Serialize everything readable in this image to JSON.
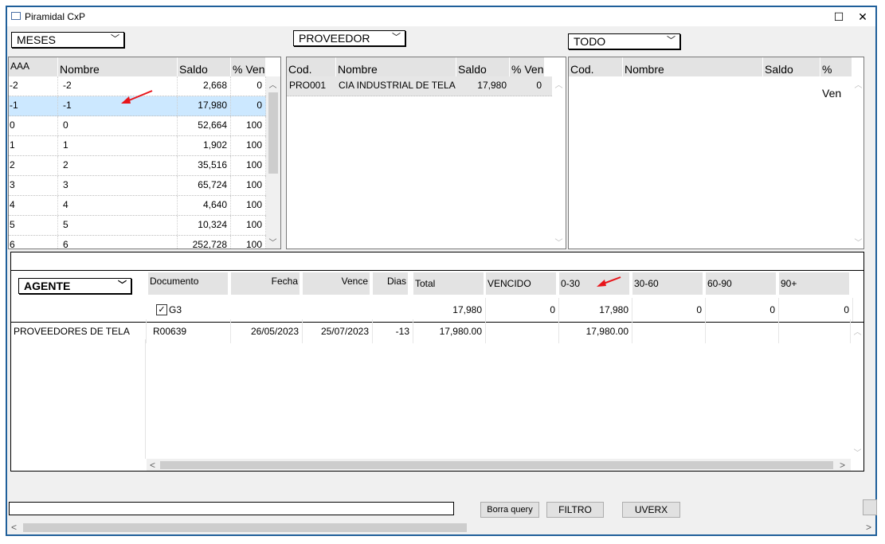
{
  "window": {
    "title": "Piramidal CxP",
    "minimize_label": "☐",
    "close_label": "✕"
  },
  "filters": {
    "group_by": "MESES",
    "entity": "PROVEEDOR",
    "scope": "TODO",
    "agent": "AGENTE"
  },
  "aging_table": {
    "headers": [
      "AAA",
      "Nombre",
      "Saldo",
      "% Ven"
    ],
    "rows": [
      [
        "-2",
        "-2",
        "2,668",
        "0"
      ],
      [
        "-1",
        "-1",
        "17,980",
        "0"
      ],
      [
        "0",
        "0",
        "52,664",
        "100"
      ],
      [
        "1",
        "1",
        "1,902",
        "100"
      ],
      [
        "2",
        "2",
        "35,516",
        "100"
      ],
      [
        "3",
        "3",
        "65,724",
        "100"
      ],
      [
        "4",
        "4",
        "4,640",
        "100"
      ],
      [
        "5",
        "5",
        "10,324",
        "100"
      ],
      [
        "6",
        "6",
        "252,728",
        "100"
      ]
    ],
    "selected_row": 1
  },
  "supplier_table": {
    "headers": [
      "Cod.",
      "Nombre",
      "Saldo",
      "% Ven"
    ],
    "rows": [
      [
        "PRO001",
        "CIA INDUSTRIAL DE TELA",
        "17,980",
        "0"
      ]
    ]
  },
  "detail_table": {
    "headers": [
      "Cod.",
      "Nombre",
      "Saldo",
      "% Ven"
    ]
  },
  "bottom": {
    "headers": [
      "Documento",
      "Fecha",
      "Vence",
      "Dias",
      "Total",
      "VENCIDO",
      "0-30",
      "30-60",
      "60-90",
      "90+"
    ],
    "group_checkbox_label": "G3",
    "totals": [
      "17,980",
      "0",
      "17,980",
      "0",
      "0",
      "0"
    ],
    "row": {
      "agent": "PROVEEDORES DE TELA",
      "documento": "R00639",
      "fecha": "26/05/2023",
      "vence": "25/07/2023",
      "dias": "-13",
      "total": "17,980.00",
      "vencido": "",
      "b0_30": "17,980.00",
      "b30_60": "",
      "b60_90": "",
      "b90": ""
    }
  },
  "buttons": {
    "borra_query": "Borra query",
    "filtro": "FILTRO",
    "uverx": "UVERX"
  },
  "colors": {
    "frame": "#1f5f9a",
    "selected_row": "#cce8ff",
    "annotation_arrow": "#e8141a"
  }
}
